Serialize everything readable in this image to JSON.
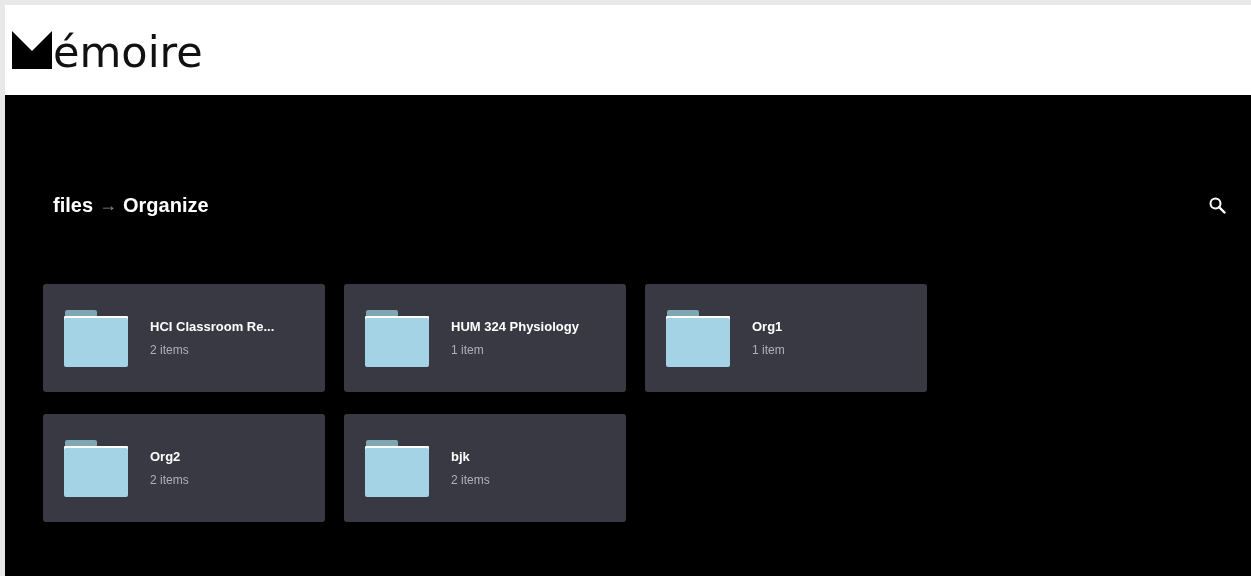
{
  "header": {
    "logo_text": "émoire"
  },
  "breadcrumb": {
    "items": [
      "files",
      "Organize"
    ],
    "separator": "→"
  },
  "folders": [
    {
      "name": "HCI Classroom Re...",
      "count": "2 items"
    },
    {
      "name": "HUM 324 Physiology",
      "count": "1 item"
    },
    {
      "name": "Org1",
      "count": "1 item"
    },
    {
      "name": "Org2",
      "count": "2 items"
    },
    {
      "name": "bjk",
      "count": "2 items"
    }
  ]
}
